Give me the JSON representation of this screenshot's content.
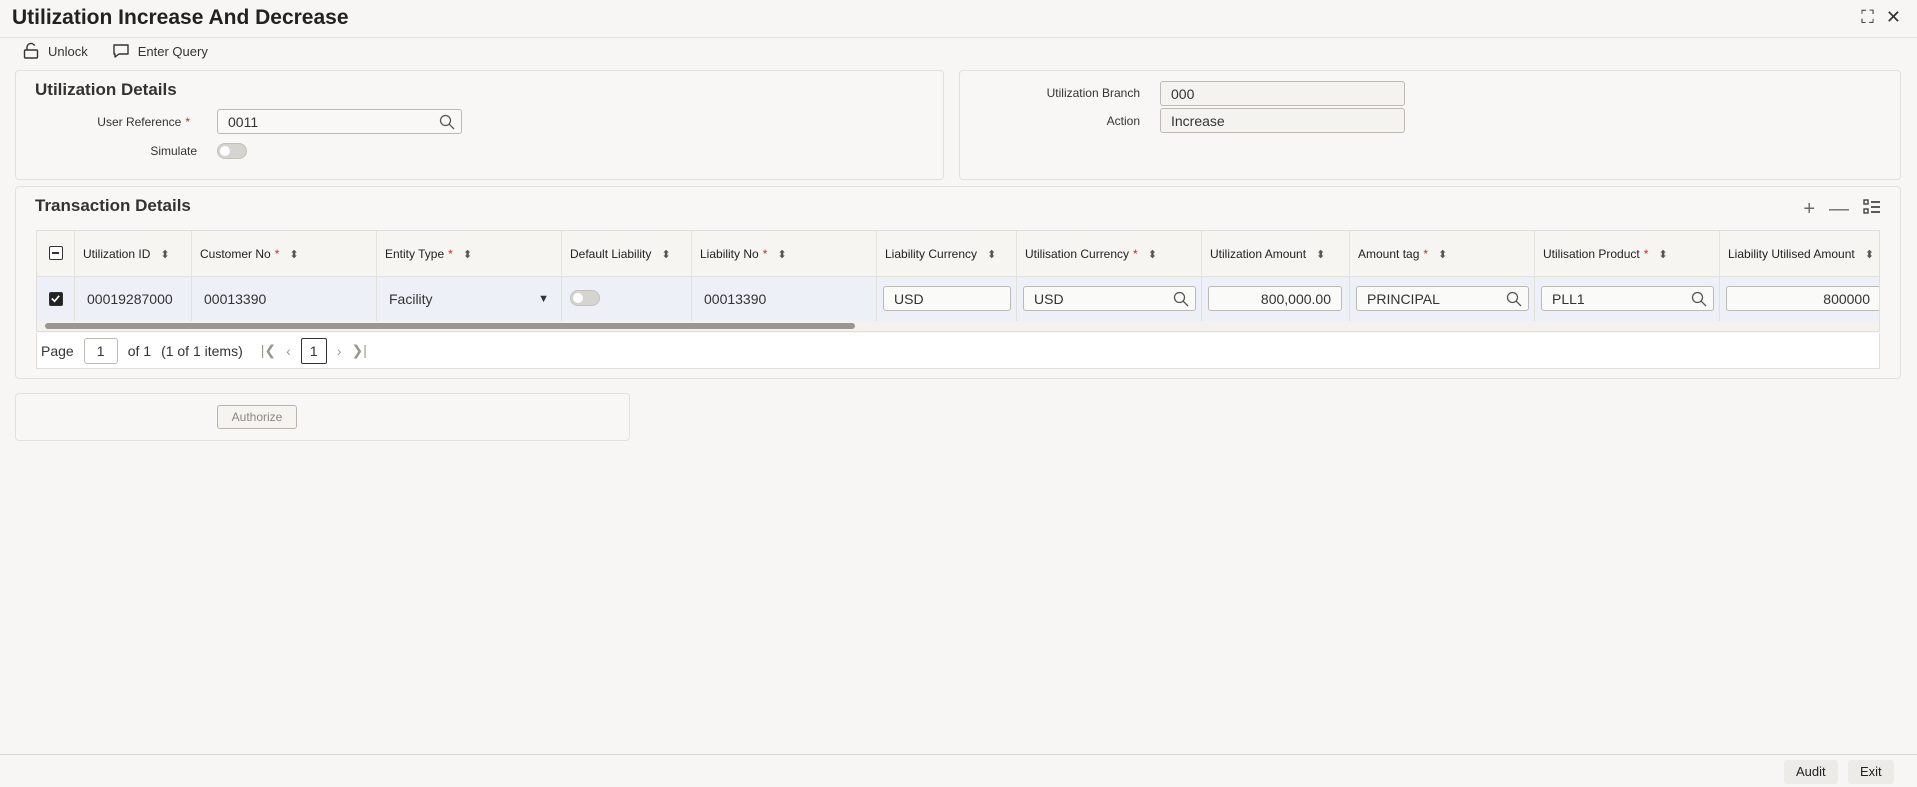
{
  "page": {
    "title": "Utilization Increase And Decrease"
  },
  "toolbar": {
    "unlock_label": "Unlock",
    "enter_query_label": "Enter Query"
  },
  "utilization_details": {
    "title": "Utilization Details",
    "user_reference_label": "User Reference",
    "user_reference_value": "0011",
    "simulate_label": "Simulate",
    "simulate_on": false,
    "branch_label": "Utilization Branch",
    "branch_value": "000",
    "action_label": "Action",
    "action_value": "Increase"
  },
  "transaction_details": {
    "title": "Transaction Details",
    "columns": [
      {
        "label": "Utilization ID",
        "required": false
      },
      {
        "label": "Customer No",
        "required": true
      },
      {
        "label": "Entity Type",
        "required": true
      },
      {
        "label": "Default Liability",
        "required": false
      },
      {
        "label": "Liability No",
        "required": true
      },
      {
        "label": "Liability Currency",
        "required": false
      },
      {
        "label": "Utilisation Currency",
        "required": true
      },
      {
        "label": "Utilization Amount",
        "required": false
      },
      {
        "label": "Amount tag",
        "required": true
      },
      {
        "label": "Utilisation Product",
        "required": true
      },
      {
        "label": "Liability Utilised Amount",
        "required": false
      }
    ],
    "rows": [
      {
        "selected": true,
        "utilization_id": "00019287000",
        "customer_no": "00013390",
        "entity_type": "Facility",
        "default_liability": false,
        "liability_no": "00013390",
        "liability_currency": "USD",
        "utilisation_currency": "USD",
        "utilization_amount": "800,000.00",
        "amount_tag": "PRINCIPAL",
        "utilisation_product": "PLL1",
        "liability_utilised_amount": "800000"
      }
    ]
  },
  "pager": {
    "page_label": "Page",
    "page_value": "1",
    "of_label": "of 1",
    "items_label": "(1 of 1 items)",
    "current_page": "1"
  },
  "actions": {
    "authorize_label": "Authorize"
  },
  "footer": {
    "audit_label": "Audit",
    "exit_label": "Exit"
  },
  "icons": {
    "unlock": "unlock-icon",
    "enter_query": "comment-icon",
    "search": "search-icon",
    "add": "plus-icon",
    "remove": "minus-icon",
    "view": "list-icon",
    "sort": "sort-icon",
    "maximize": "maximize-icon",
    "close": "close-icon"
  },
  "colors": {
    "required": "#c72a2a",
    "row_selected_bg": "#eef0f8",
    "scroll_thumb": "#9a9791"
  }
}
